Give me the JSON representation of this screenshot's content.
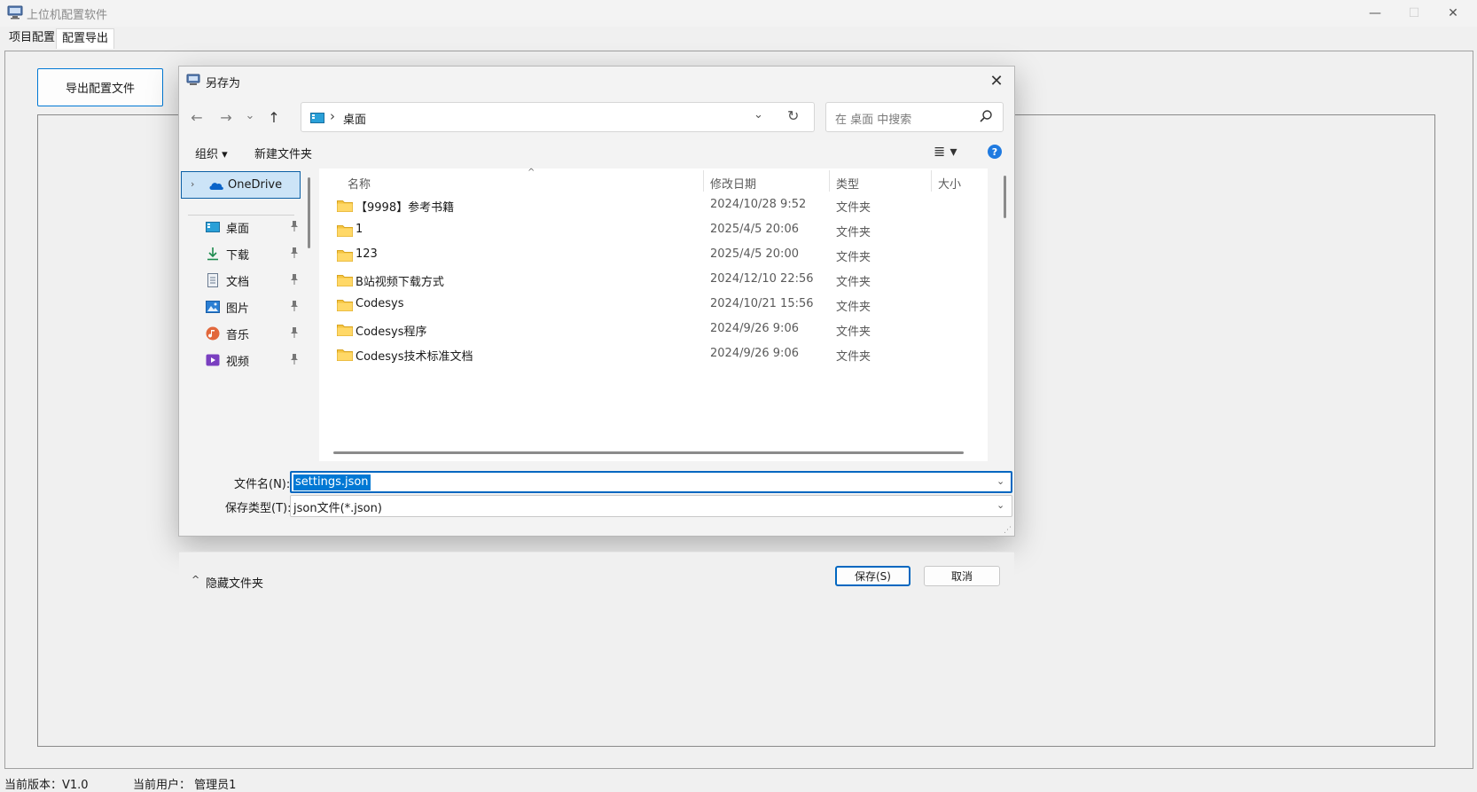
{
  "window": {
    "title": "上位机配置软件",
    "minimize": "—",
    "maximize": "☐",
    "close": "✕"
  },
  "tabs": [
    {
      "label": "项目配置"
    },
    {
      "label": "配置导出"
    }
  ],
  "export_button": "导出配置文件",
  "status": {
    "version": "当前版本：V1.0",
    "user": "当前用户：   管理员1"
  },
  "dialog": {
    "title": "另存为",
    "close": "✕",
    "nav": {
      "back": "←",
      "forward": "→",
      "recent": "⌄",
      "up": "↑"
    },
    "address": {
      "separator": "›",
      "location": "桌面",
      "dropdown": "⌄",
      "refresh": "↻"
    },
    "search_placeholder": "在 桌面 中搜索",
    "toolbar": {
      "organize": "组织 ▾",
      "new_folder": "新建文件夹",
      "view": "≣ ▾",
      "help": "?"
    },
    "nav_pane": {
      "onedrive": {
        "chevron": "›",
        "label": "OneDrive"
      },
      "quick_access": [
        {
          "label": "桌面",
          "icon": "desktop-icon"
        },
        {
          "label": "下载",
          "icon": "download-icon"
        },
        {
          "label": "文档",
          "icon": "document-icon"
        },
        {
          "label": "图片",
          "icon": "picture-icon"
        },
        {
          "label": "音乐",
          "icon": "music-icon"
        },
        {
          "label": "视频",
          "icon": "video-icon"
        }
      ]
    },
    "columns": {
      "name": "名称",
      "date": "修改日期",
      "type": "类型",
      "size": "大小",
      "sort_caret": "^"
    },
    "files": [
      {
        "name": "【9998】参考书籍",
        "date": "2024/10/28 9:52",
        "type": "文件夹"
      },
      {
        "name": "1",
        "date": "2025/4/5 20:06",
        "type": "文件夹"
      },
      {
        "name": "123",
        "date": "2025/4/5 20:00",
        "type": "文件夹"
      },
      {
        "name": "B站视频下载方式",
        "date": "2024/12/10 22:56",
        "type": "文件夹"
      },
      {
        "name": "Codesys",
        "date": "2024/10/21 15:56",
        "type": "文件夹"
      },
      {
        "name": "Codesys程序",
        "date": "2024/9/26 9:06",
        "type": "文件夹"
      },
      {
        "name": "Codesys技术标准文档",
        "date": "2024/9/26 9:06",
        "type": "文件夹"
      }
    ],
    "filename_label": "文件名(N):",
    "filename_value": "settings.json",
    "filetype_label": "保存类型(T):",
    "filetype_value": "json文件(*.json)",
    "dropdown_glyph": "⌄",
    "hide_folders": {
      "chevron": "^",
      "label": "隐藏文件夹"
    },
    "save_button": "保存(S)",
    "cancel_button": "取消"
  },
  "colors": {
    "accent": "#0078d4",
    "folder": "#f5c542",
    "selection_bg": "#cce4f7"
  }
}
